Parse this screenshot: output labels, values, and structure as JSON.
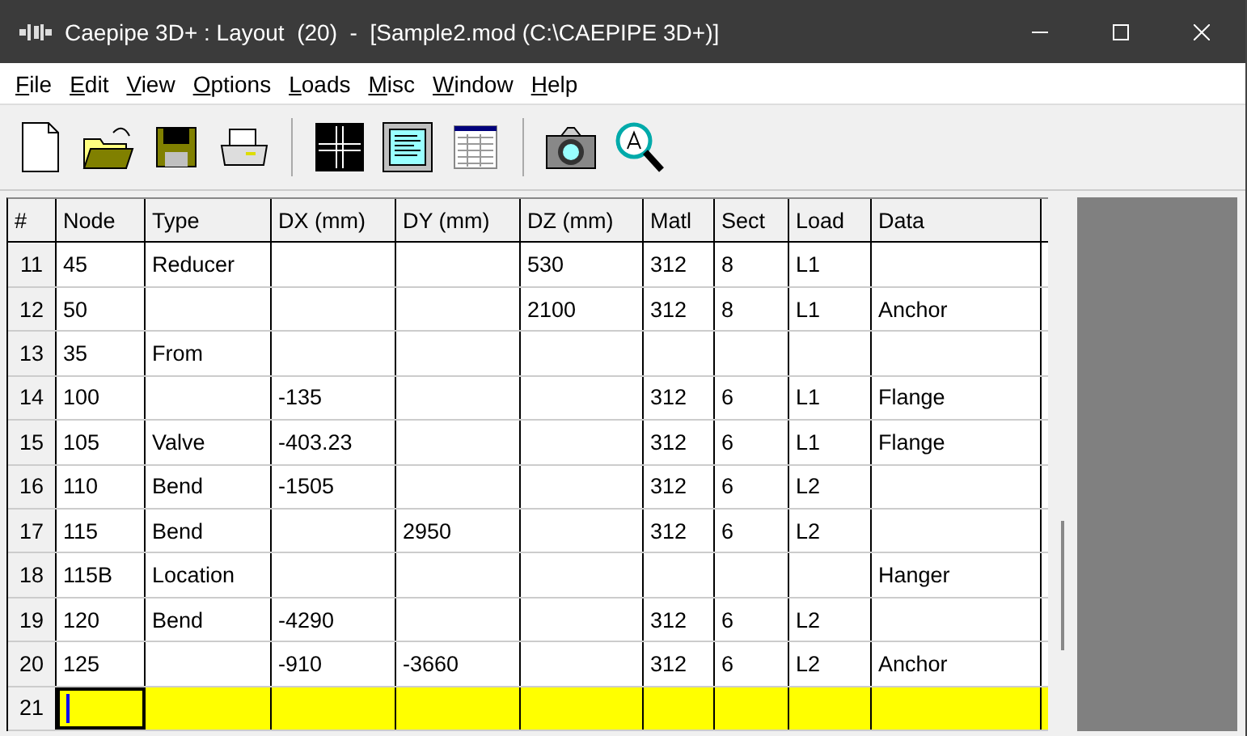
{
  "window": {
    "title": "Caepipe 3D+ : Layout  (20)  -  [Sample2.mod (C:\\CAEPIPE 3D+)]"
  },
  "menu": [
    "File",
    "Edit",
    "View",
    "Options",
    "Loads",
    "Misc",
    "Window",
    "Help"
  ],
  "table": {
    "columns": [
      "#",
      "Node",
      "Type",
      "DX (mm)",
      "DY (mm)",
      "DZ (mm)",
      "Matl",
      "Sect",
      "Load",
      "Data"
    ],
    "rows": [
      {
        "cells": [
          "11",
          "45",
          "Reducer",
          "",
          "",
          "530",
          "312",
          "8",
          "L1",
          ""
        ],
        "selected": false
      },
      {
        "cells": [
          "12",
          "50",
          "",
          "",
          "",
          "2100",
          "312",
          "8",
          "L1",
          "Anchor"
        ],
        "selected": false
      },
      {
        "cells": [
          "13",
          "35",
          "From",
          "",
          "",
          "",
          "",
          "",
          "",
          ""
        ],
        "selected": false
      },
      {
        "cells": [
          "14",
          "100",
          "",
          "-135",
          "",
          "",
          "312",
          "6",
          "L1",
          "Flange"
        ],
        "selected": false
      },
      {
        "cells": [
          "15",
          "105",
          "Valve",
          "-403.23",
          "",
          "",
          "312",
          "6",
          "L1",
          "Flange"
        ],
        "selected": false
      },
      {
        "cells": [
          "16",
          "110",
          "Bend",
          "-1505",
          "",
          "",
          "312",
          "6",
          "L2",
          ""
        ],
        "selected": false
      },
      {
        "cells": [
          "17",
          "115",
          "Bend",
          "",
          "2950",
          "",
          "312",
          "6",
          "L2",
          ""
        ],
        "selected": false
      },
      {
        "cells": [
          "18",
          "115B",
          "Location",
          "",
          "",
          "",
          "",
          "",
          "",
          "Hanger"
        ],
        "selected": false
      },
      {
        "cells": [
          "19",
          "120",
          "Bend",
          "-4290",
          "",
          "",
          "312",
          "6",
          "L2",
          ""
        ],
        "selected": false
      },
      {
        "cells": [
          "20",
          "125",
          "",
          "-910",
          "-3660",
          "",
          "312",
          "6",
          "L2",
          "Anchor"
        ],
        "selected": false
      },
      {
        "cells": [
          "21",
          "",
          "",
          "",
          "",
          "",
          "",
          "",
          "",
          ""
        ],
        "selected": true
      }
    ]
  }
}
